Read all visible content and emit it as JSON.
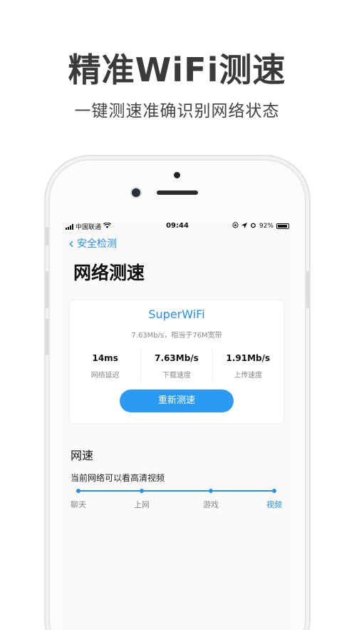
{
  "promo": {
    "headline": "精准WiFi测速",
    "subline": "一键测速准确识别网络状态"
  },
  "statusbar": {
    "carrier": "中国联通",
    "time": "09:44",
    "battery": "92%",
    "battery_level": 0.92
  },
  "nav": {
    "back_label": "安全检测"
  },
  "page": {
    "title": "网络测速"
  },
  "result": {
    "ssid": "SuperWiFi",
    "summary": "7.63Mb/s，相当于76M宽带",
    "stats": [
      {
        "value": "14ms",
        "label": "网络延迟"
      },
      {
        "value": "7.63Mb/s",
        "label": "下载速度"
      },
      {
        "value": "1.91Mb/s",
        "label": "上传速度"
      }
    ],
    "retest_label": "重新测速"
  },
  "speed": {
    "title": "网速",
    "description": "当前网络可以看高清视频",
    "levels": [
      "聊天",
      "上网",
      "游戏",
      "视频"
    ],
    "active_level": "视频"
  },
  "colors": {
    "accent": "#2a8ee8",
    "button": "#2a9bf5"
  }
}
